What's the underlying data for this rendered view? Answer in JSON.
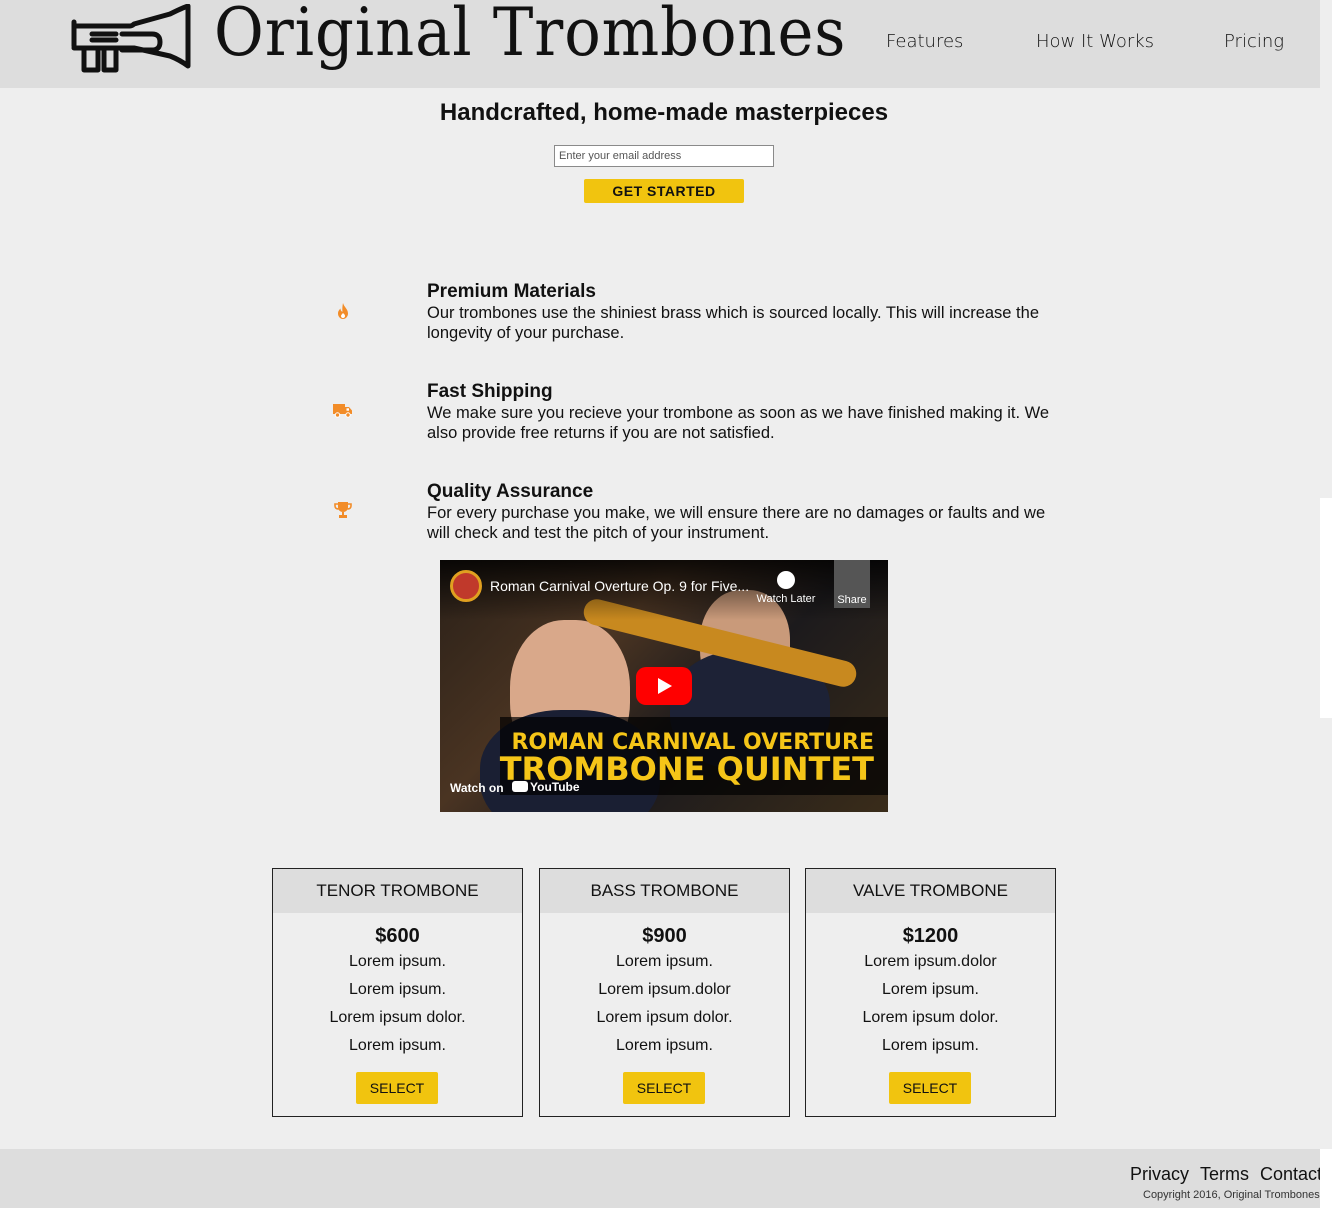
{
  "header": {
    "brand": "Original Trombones",
    "nav": [
      "Features",
      "How It Works",
      "Pricing"
    ]
  },
  "hero": {
    "title": "Handcrafted, home-made masterpieces",
    "email_placeholder": "Enter your email address",
    "cta": "GET STARTED"
  },
  "features": [
    {
      "icon": "fire-icon",
      "title": "Premium Materials",
      "text": "Our trombones use the shiniest brass which is sourced locally. This will increase the longevity of your purchase."
    },
    {
      "icon": "truck-icon",
      "title": "Fast Shipping",
      "text": "We make sure you recieve your trombone as soon as we have finished making it. We also provide free returns if you are not satisfied."
    },
    {
      "icon": "trophy-icon",
      "title": "Quality Assurance",
      "text": "For every purchase you make, we will ensure there are no damages or faults and we will check and test the pitch of your instrument."
    }
  ],
  "video": {
    "title": "Roman Carnival Overture Op. 9 for Five...",
    "watch_later": "Watch Later",
    "share": "Share",
    "banner_line1": "ROMAN CARNIVAL OVERTURE",
    "banner_line2": "TROMBONE QUINTET",
    "watch_on": "Watch on",
    "youtube": "YouTube"
  },
  "pricing": [
    {
      "name": "TENOR TROMBONE",
      "price": "$600",
      "items": [
        "Lorem ipsum.",
        "Lorem ipsum.",
        "Lorem ipsum dolor.",
        "Lorem ipsum."
      ],
      "button": "SELECT"
    },
    {
      "name": "BASS TROMBONE",
      "price": "$900",
      "items": [
        "Lorem ipsum.",
        "Lorem ipsum.dolor",
        "Lorem ipsum dolor.",
        "Lorem ipsum."
      ],
      "button": "SELECT"
    },
    {
      "name": "VALVE TROMBONE",
      "price": "$1200",
      "items": [
        "Lorem ipsum.dolor",
        "Lorem ipsum.",
        "Lorem ipsum dolor.",
        "Lorem ipsum."
      ],
      "button": "SELECT"
    }
  ],
  "footer": {
    "links": [
      "Privacy",
      "Terms",
      "Contact"
    ],
    "copyright": "Copyright 2016, Original Trombones"
  },
  "colors": {
    "accent": "#f1c40f",
    "icon": "#f28c28",
    "header_bg": "#dddddd",
    "page_bg": "#eeeeee"
  }
}
